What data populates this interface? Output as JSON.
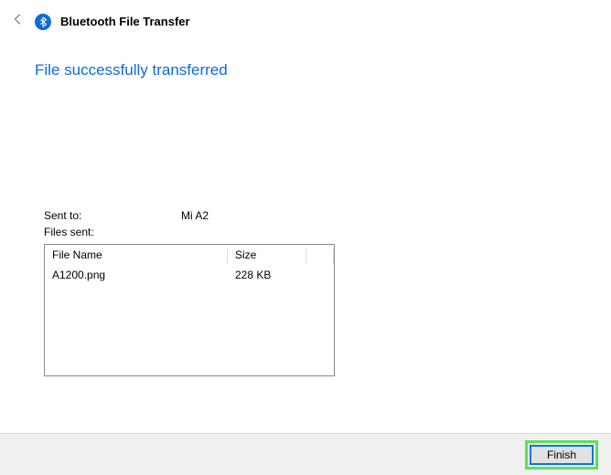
{
  "header": {
    "title": "Bluetooth File Transfer"
  },
  "main": {
    "heading": "File successfully transferred",
    "sent_to_label": "Sent to:",
    "sent_to_value": "Mi A2",
    "files_sent_label": "Files sent:"
  },
  "table": {
    "columns": {
      "name": "File Name",
      "size": "Size"
    },
    "rows": [
      {
        "name": "A1200.png",
        "size": "228 KB"
      }
    ]
  },
  "footer": {
    "finish_label": "Finish"
  }
}
